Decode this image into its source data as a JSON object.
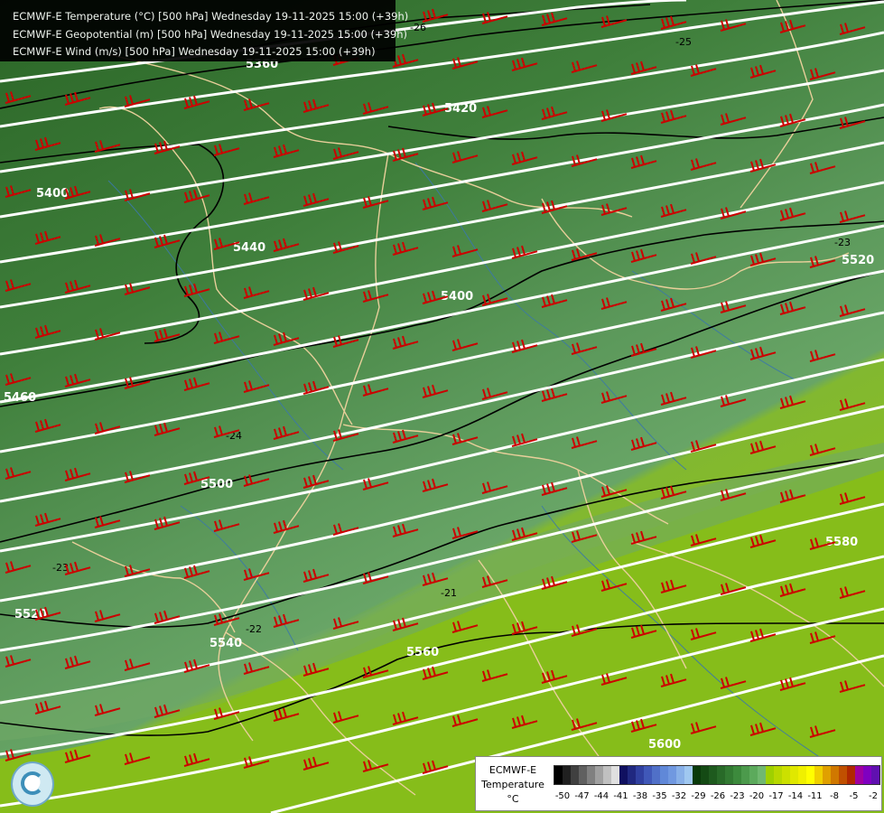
{
  "header": {
    "lines": [
      "ECMWF-E Temperature (°C) [500 hPa] Wednesday 19-11-2025 15:00 (+39h)",
      "ECMWF-E Geopotential (m) [500 hPa] Wednesday 19-11-2025 15:00 (+39h)",
      "ECMWF-E Wind (m/s) [500 hPa] Wednesday 19-11-2025 15:00 (+39h)"
    ]
  },
  "map": {
    "geopotential_labels": [
      "5360",
      "5420",
      "5400",
      "5440",
      "5400",
      "5460",
      "5500",
      "5520",
      "5540",
      "5560",
      "5580",
      "5600",
      "5520"
    ],
    "temperature_labels": [
      "-26",
      "-25",
      "-23",
      "-24",
      "-23",
      "-21",
      "-22"
    ],
    "colors": {
      "dark_green": "#2e6a2a",
      "mid_green": "#4e8a4c",
      "light_green": "#65a465",
      "lime": "#8cbf1e",
      "contour_white": "#ffffff",
      "isotherm_black": "#000000",
      "wind_barb": "#cc0000",
      "borders": "#e8cf9a",
      "rivers": "#3c78a8"
    }
  },
  "legend": {
    "source": "ECMWF-E",
    "variable": "Temperature",
    "unit": "°C",
    "ticks": [
      "-50",
      "-47",
      "-44",
      "-41",
      "-38",
      "-35",
      "-32",
      "-29",
      "-26",
      "-23",
      "-20",
      "-17",
      "-14",
      "-11",
      "-8",
      "-5",
      "-2"
    ],
    "colors": [
      "#000000",
      "#202020",
      "#404040",
      "#606060",
      "#808080",
      "#a0a0a0",
      "#c0c0c0",
      "#e0e0e0",
      "#101060",
      "#202880",
      "#3040a0",
      "#4058b8",
      "#5070c8",
      "#6088d8",
      "#7098e0",
      "#88b0e8",
      "#a0c8f0",
      "#0a3a0a",
      "#144a14",
      "#1e5a1e",
      "#286a28",
      "#327a32",
      "#3c8a3c",
      "#4c9a4c",
      "#5caa5c",
      "#70b870",
      "#9fd000",
      "#b8d800",
      "#cce000",
      "#e0e800",
      "#f0f000",
      "#ffff00",
      "#f0d000",
      "#e0a000",
      "#d07800",
      "#c05000",
      "#b02800",
      "#a000a0",
      "#8000c0",
      "#6010b0",
      "#402090"
    ]
  },
  "logo": {
    "icon": "ecmwf-swirl-icon"
  }
}
